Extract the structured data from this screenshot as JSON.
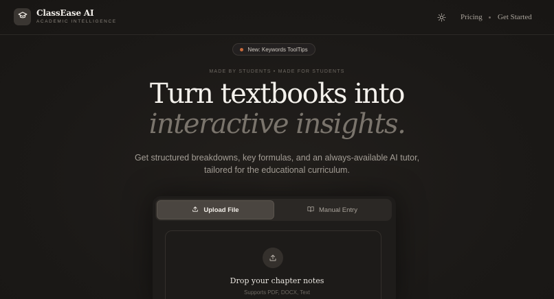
{
  "header": {
    "brand_name": "ClassEase AI",
    "brand_sub": "ACADEMIC INTELLIGENCE",
    "logo_icon": "graduation-cap-icon",
    "theme_icon": "sun-icon",
    "nav": {
      "pricing": "Pricing",
      "get_started": "Get Started"
    }
  },
  "hero": {
    "badge": "New: Keywords ToolTips",
    "badge_dot_color": "#c86a3b",
    "tagline": "MADE BY STUDENTS • MADE FOR STUDENTS",
    "headline_line1": "Turn textbooks into",
    "headline_line2": "interactive insights.",
    "subcopy": "Get structured breakdowns, key formulas, and an always-available AI tutor, tailored for the educational curriculum."
  },
  "input_card": {
    "tabs": [
      {
        "label": "Upload File",
        "icon": "upload-icon",
        "active": true
      },
      {
        "label": "Manual Entry",
        "icon": "book-open-icon",
        "active": false
      }
    ],
    "dropzone": {
      "icon": "upload-icon",
      "title": "Drop your chapter notes",
      "subtitle": "Supports PDF, DOCX, Text"
    }
  },
  "colors": {
    "background": "#1c1a18",
    "accent": "#c86a3b",
    "text_primary": "#f4f1ec",
    "text_muted": "#7a746c"
  }
}
